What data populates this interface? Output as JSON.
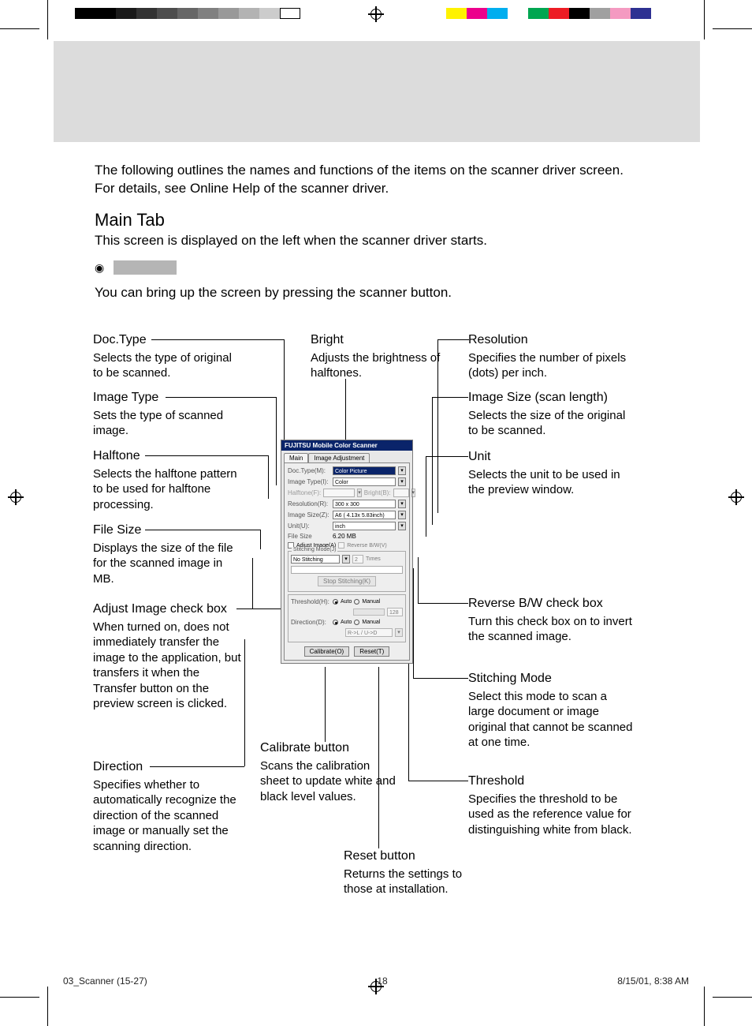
{
  "intro": {
    "line1": "The following outlines the names and functions of the items on the scanner driver screen.",
    "line2": "For details, see Online Help of the scanner driver."
  },
  "section": {
    "heading": "Main Tab",
    "sub": "This screen is displayed on the left when the scanner driver starts.",
    "bring_up": "You can bring up the screen by pressing the scanner button."
  },
  "callouts_left": {
    "doctype": {
      "title": "Doc.Type",
      "desc": "Selects the type of original to be scanned."
    },
    "imagetype": {
      "title": "Image Type",
      "desc": "Sets the type of scanned image."
    },
    "halftone": {
      "title": "Halftone",
      "desc": "Selects the halftone pattern to be used for halftone processing."
    },
    "filesize": {
      "title": "File Size",
      "desc": "Displays the size of the file for the scanned image in MB."
    },
    "adjust": {
      "title": "Adjust Image check box",
      "desc": "When turned on, does not immediately transfer the image to the application, but transfers it when the Transfer button on the preview screen is clicked."
    },
    "direction": {
      "title": "Direction",
      "desc": "Specifies whether to automatically recognize the direction of the scanned image or manually set the scanning direction."
    }
  },
  "callouts_center": {
    "bright": {
      "title": "Bright",
      "desc": "Adjusts the brightness of halftones."
    },
    "calibrate": {
      "title": "Calibrate button",
      "desc": "Scans the calibration sheet to update white and black level values."
    },
    "reset": {
      "title": "Reset button",
      "desc": "Returns the settings to those at installation."
    }
  },
  "callouts_right": {
    "resolution": {
      "title": "Resolution",
      "desc": "Specifies the number of pixels (dots) per inch."
    },
    "imagesize": {
      "title": "Image Size (scan length)",
      "desc": "Selects the size of the original to be scanned."
    },
    "unit": {
      "title": "Unit",
      "desc": "Selects the unit to be used in the preview window."
    },
    "reverse": {
      "title": "Reverse B/W check box",
      "desc": "Turn this check box on to invert the scanned image."
    },
    "stitching": {
      "title": "Stitching Mode",
      "desc": "Select this mode to scan a large document or image original that cannot be scanned at one time."
    },
    "threshold": {
      "title": "Threshold",
      "desc": "Specifies the threshold to be used as the reference value for distinguishing white from black."
    }
  },
  "screenshot": {
    "window_title": "FUJITSU Mobile Color Scanner",
    "tab_main": "Main",
    "tab_adjust": "Image Adjustment",
    "doctype_label": "Doc.Type(M):",
    "doctype_value": "Color Picture",
    "imagetype_label": "Image Type(I):",
    "imagetype_value": "Color",
    "halftone_label": "Halftone(F):",
    "bright_label": "Bright(B):",
    "resolution_label": "Resolution(R):",
    "resolution_value": "300 x 300",
    "imagesize_label": "Image Size(Z):",
    "imagesize_value": "A6 ( 4.13x 5.83inch)",
    "unit_label": "Unit(U):",
    "unit_value": "inch",
    "filesize_label": "File Size",
    "filesize_value": "6.20    MB",
    "adjust_label": "Adjust Image(A)",
    "reverse_label": "Reverse B/W(V)",
    "stitching_group": "Stitching Mode(J)",
    "stitching_value": "No Stitching",
    "stitching_times_value": "2",
    "stitching_times_suffix": "Times",
    "stop_stitching": "Stop Stitching(K)",
    "threshold_label": "Threshold(H):",
    "threshold_auto": "Auto",
    "threshold_manual": "Manual",
    "threshold_value": "128",
    "direction_label": "Direction(D):",
    "direction_auto": "Auto",
    "direction_manual": "Manual",
    "direction_value": "R->L / U->D",
    "calibrate_btn": "Calibrate(O)",
    "reset_btn": "Reset(T)"
  },
  "footer": {
    "file": "03_Scanner (15-27)",
    "page": "18",
    "date": "8/15/01, 8:38 AM"
  },
  "color_strips": {
    "left": [
      "#000000",
      "#000000",
      "#1a1a1a",
      "#333333",
      "#4d4d4d",
      "#666666",
      "#808080",
      "#999999",
      "#b3b3b3",
      "#cccccc",
      "#ffffff"
    ],
    "right": [
      "#ffffff",
      "#fff200",
      "#ec008c",
      "#00aeef",
      "#ffffff",
      "#00a651",
      "#ed1c24",
      "#000000",
      "#a0a0a0",
      "#f49ac1",
      "#2e3192"
    ]
  }
}
